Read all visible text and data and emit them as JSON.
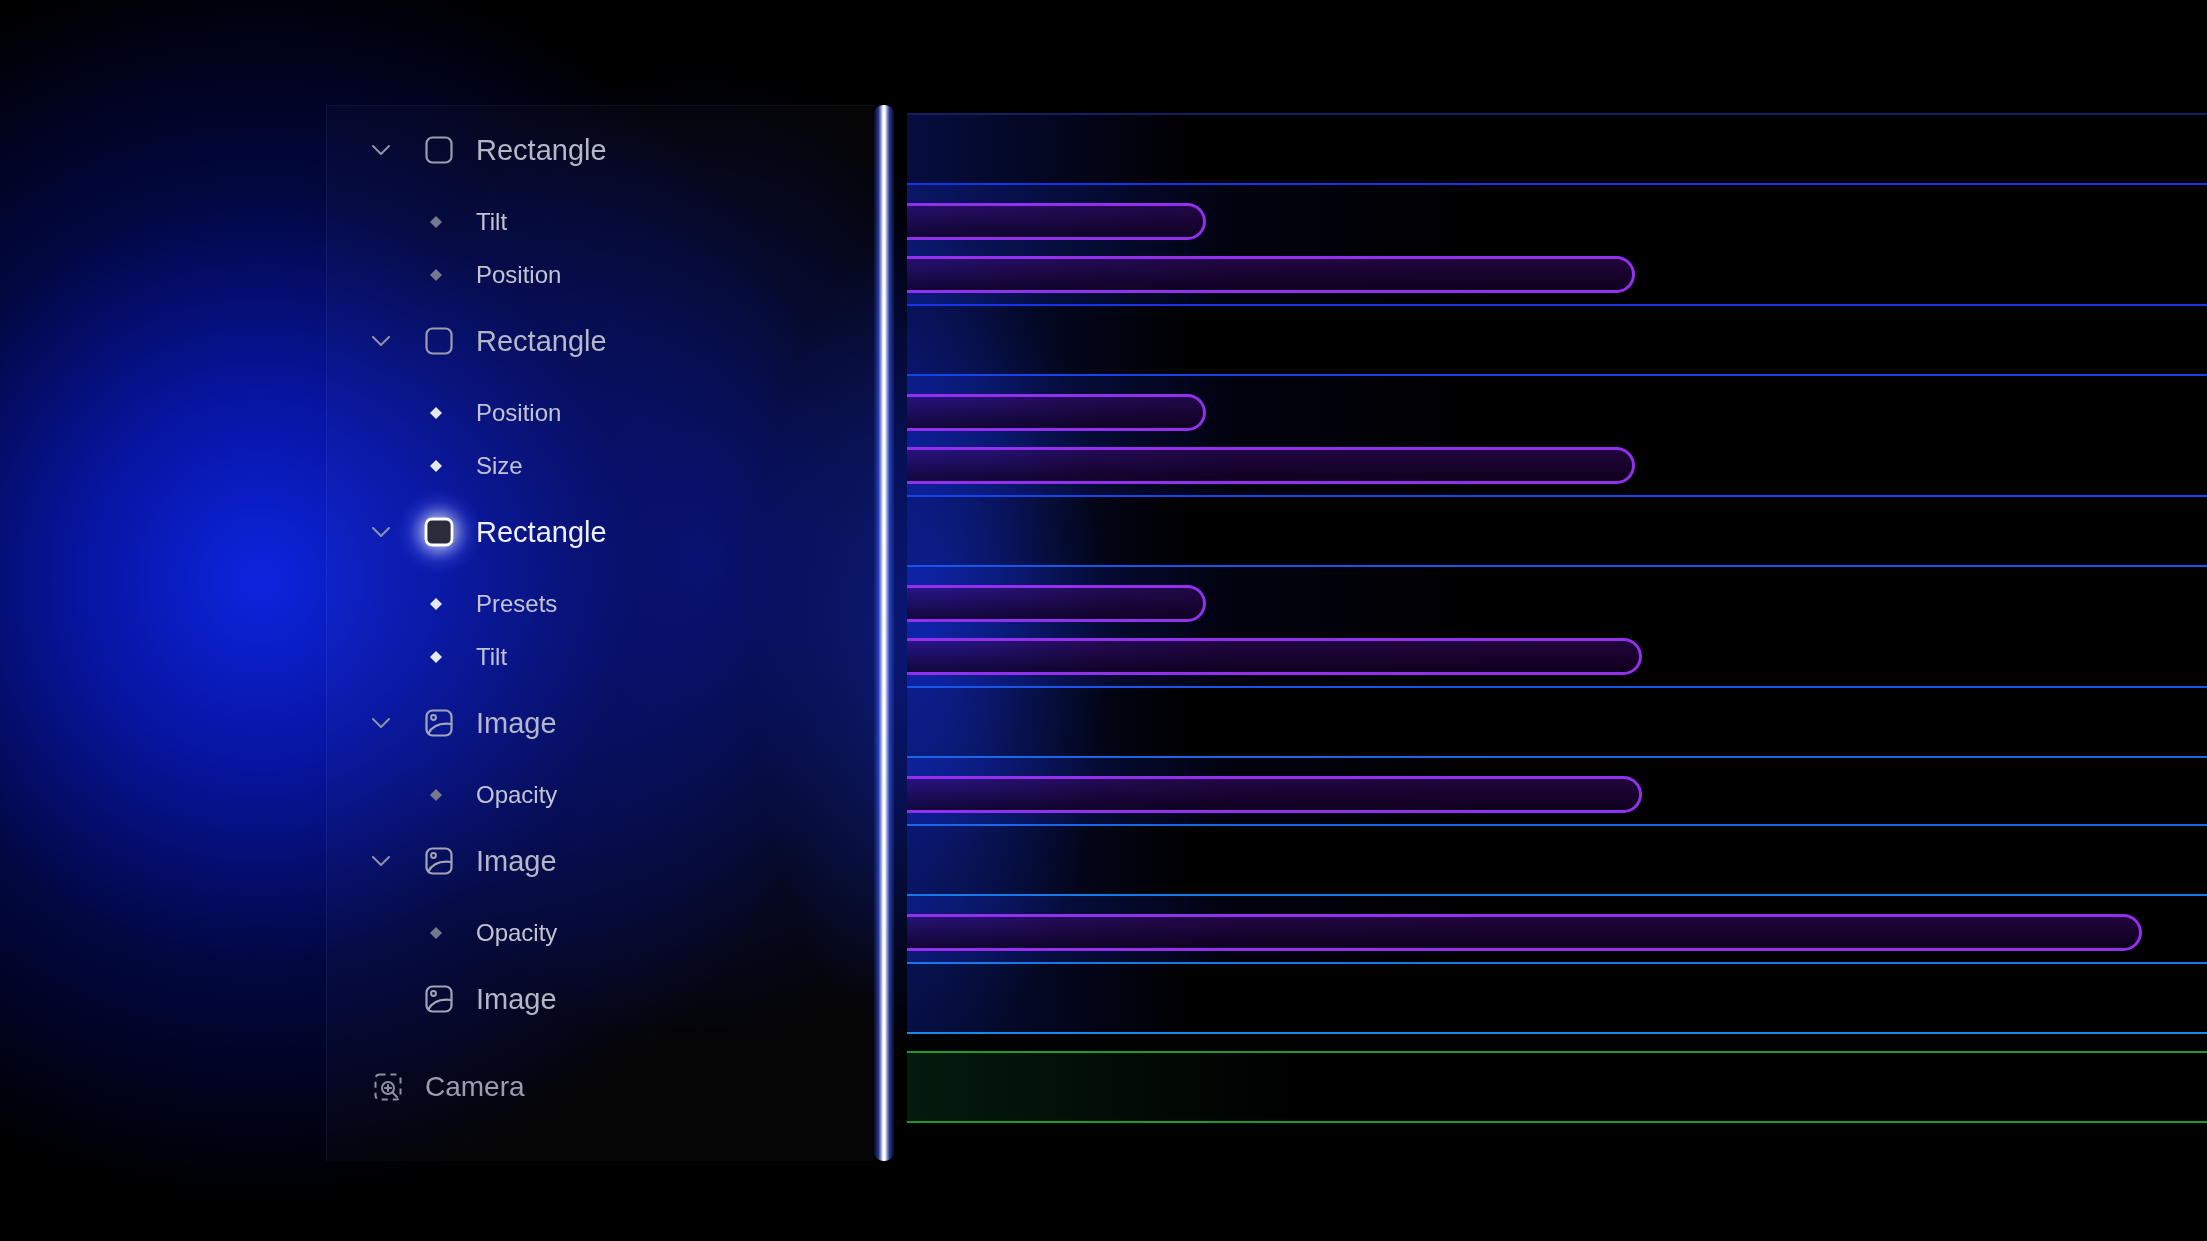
{
  "layers": [
    {
      "kind": "rectangle",
      "label": "Rectangle",
      "expanded": true,
      "selected": false,
      "children": [
        {
          "label": "Tilt",
          "active": false,
          "level": 0.23
        },
        {
          "label": "Position",
          "active": false,
          "level": 0.56
        }
      ]
    },
    {
      "kind": "rectangle",
      "label": "Rectangle",
      "expanded": true,
      "selected": false,
      "children": [
        {
          "label": "Position",
          "active": true,
          "level": 0.23
        },
        {
          "label": "Size",
          "active": true,
          "level": 0.56
        }
      ]
    },
    {
      "kind": "rectangle",
      "label": "Rectangle",
      "expanded": true,
      "selected": true,
      "children": [
        {
          "label": "Presets",
          "active": true,
          "level": 0.23
        },
        {
          "label": "Tilt",
          "active": true,
          "level": 0.565
        }
      ]
    },
    {
      "kind": "image",
      "label": "Image",
      "expanded": true,
      "selected": false,
      "children": [
        {
          "label": "Opacity",
          "active": false,
          "level": 0.565
        }
      ]
    },
    {
      "kind": "image",
      "label": "Image",
      "expanded": true,
      "selected": false,
      "children": [
        {
          "label": "Opacity",
          "active": false,
          "level": 0.95
        }
      ]
    },
    {
      "kind": "image",
      "label": "Image",
      "selected": false
    }
  ],
  "camera": {
    "label": "Camera"
  }
}
